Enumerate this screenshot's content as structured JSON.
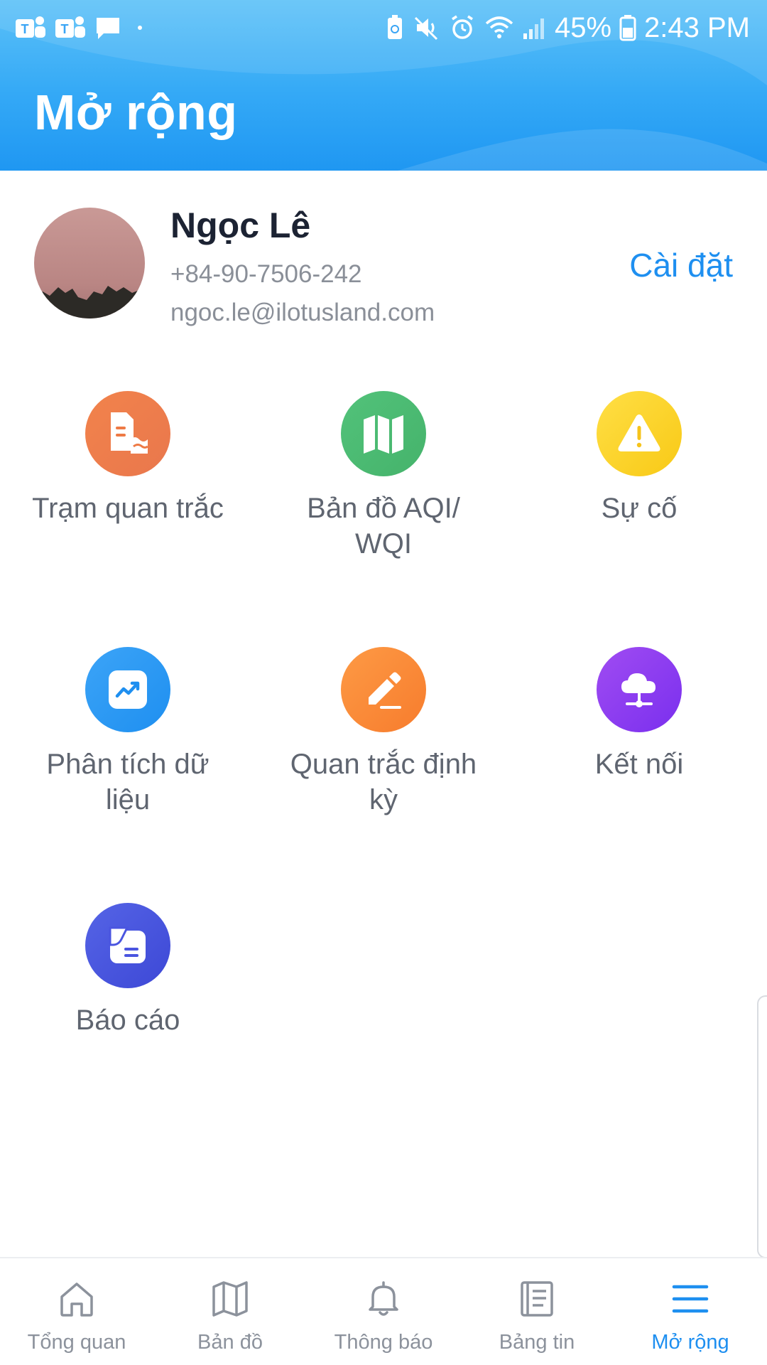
{
  "status_bar": {
    "battery": "45%",
    "time": "2:43 PM"
  },
  "header": {
    "title": "Mở rộng"
  },
  "profile": {
    "name": "Ngọc Lê",
    "phone": "+84-90-7506-242",
    "email": "ngoc.le@ilotusland.com",
    "settings_label": "Cài đặt"
  },
  "features": [
    {
      "label": "Trạm quan trắc",
      "icon": "monitoring-station-icon",
      "color": "#ee7a45"
    },
    {
      "label": "Bản đồ AQI/ WQI",
      "icon": "map-icon",
      "color": "#4cbb72"
    },
    {
      "label": "Sự cố",
      "icon": "warning-icon",
      "color": "#fcd027"
    },
    {
      "label": "Phân tích dữ liệu",
      "icon": "chart-analysis-icon",
      "color": "#2d98f4"
    },
    {
      "label": "Quan trắc định kỳ",
      "icon": "edit-pencil-icon",
      "color": "#fb8a3a"
    },
    {
      "label": "Kết nối",
      "icon": "cloud-network-icon",
      "color": "#8a3cf0"
    },
    {
      "label": "Báo cáo",
      "icon": "report-icon",
      "color": "#4a55e0"
    }
  ],
  "bottom_nav": [
    {
      "label": "Tổng quan",
      "icon": "home-icon",
      "active": false
    },
    {
      "label": "Bản đồ",
      "icon": "map-outline-icon",
      "active": false
    },
    {
      "label": "Thông báo",
      "icon": "bell-icon",
      "active": false
    },
    {
      "label": "Bảng tin",
      "icon": "newsfeed-icon",
      "active": false
    },
    {
      "label": "Mở rộng",
      "icon": "menu-icon",
      "active": true
    }
  ],
  "colors": {
    "accent": "#1e8ff0",
    "header_gradient_top": "#5cc1f8",
    "header_gradient_bottom": "#1f97f2"
  }
}
